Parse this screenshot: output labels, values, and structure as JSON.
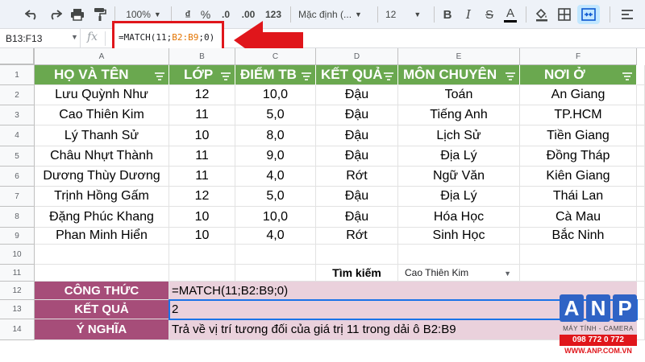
{
  "toolbar": {
    "zoom": "100%",
    "currency": "₫",
    "percent": "%",
    "dec_decrease": ".0",
    "dec_increase": ".00",
    "more_formats": "123",
    "font_name": "Mặc định (...",
    "font_size": "12",
    "bold": "B",
    "italic": "I",
    "strike": "S",
    "text_color": "A"
  },
  "formula_bar": {
    "name_box": "B13:F13",
    "fx": "fx",
    "formula_prefix": "=MATCH(11;",
    "formula_range": "B2:B9",
    "formula_suffix": ";0)"
  },
  "columns": [
    "A",
    "B",
    "C",
    "D",
    "E",
    "F"
  ],
  "rows": [
    "1",
    "2",
    "3",
    "4",
    "5",
    "6",
    "7",
    "8",
    "9",
    "10",
    "11",
    "12",
    "13",
    "14"
  ],
  "table": {
    "headers": [
      "HỌ VÀ TÊN",
      "LỚP",
      "ĐIỂM TB",
      "KẾT QUẢ",
      "MÔN CHUYÊN",
      "NƠI Ở"
    ],
    "data": [
      [
        "Lưu Quỳnh Như",
        "12",
        "10,0",
        "Đậu",
        "Toán",
        "An Giang"
      ],
      [
        "Cao Thiên Kim",
        "11",
        "5,0",
        "Đậu",
        "Tiếng Anh",
        "TP.HCM"
      ],
      [
        "Lý Thanh Sử",
        "10",
        "8,0",
        "Đậu",
        "Lịch Sử",
        "Tiền Giang"
      ],
      [
        "Châu Nhựt Thành",
        "11",
        "9,0",
        "Đậu",
        "Địa Lý",
        "Đồng Tháp"
      ],
      [
        "Dương Thùy Dương",
        "11",
        "4,0",
        "Rớt",
        "Ngữ Văn",
        "Kiên Giang"
      ],
      [
        "Trịnh Hồng Gấm",
        "12",
        "5,0",
        "Đậu",
        "Địa Lý",
        "Thái Lan"
      ],
      [
        "Đặng Phúc Khang",
        "10",
        "10,0",
        "Đậu",
        "Hóa Học",
        "Cà Mau"
      ],
      [
        "Phan Minh Hiển",
        "10",
        "4,0",
        "Rớt",
        "Sinh Học",
        "Bắc Ninh"
      ]
    ]
  },
  "search": {
    "label": "Tìm kiếm",
    "value": "Cao Thiên Kim"
  },
  "summary": {
    "formula_label": "CÔNG THỨC",
    "formula_value": "=MATCH(11;B2:B9;0)",
    "result_label": "KẾT QUẢ",
    "result_value": "2",
    "meaning_label": "Ý NGHĨA",
    "meaning_value": "Trả về vị trí tương đối của giá trị 11 trong dải ô B2:B9"
  },
  "logo": {
    "letters": [
      "A",
      "N",
      "P"
    ],
    "tagline": "MÁY TÍNH - CAMERA",
    "phone": "098 772 0 772",
    "website": "WWW.ANP.COM.VN"
  },
  "colors": {
    "header_green": "#6aa84f",
    "label_purple": "#a64d79",
    "pink_fill": "#ead1dc",
    "highlight_red": "#e0161b",
    "logo_blue": "#2f63c5"
  }
}
